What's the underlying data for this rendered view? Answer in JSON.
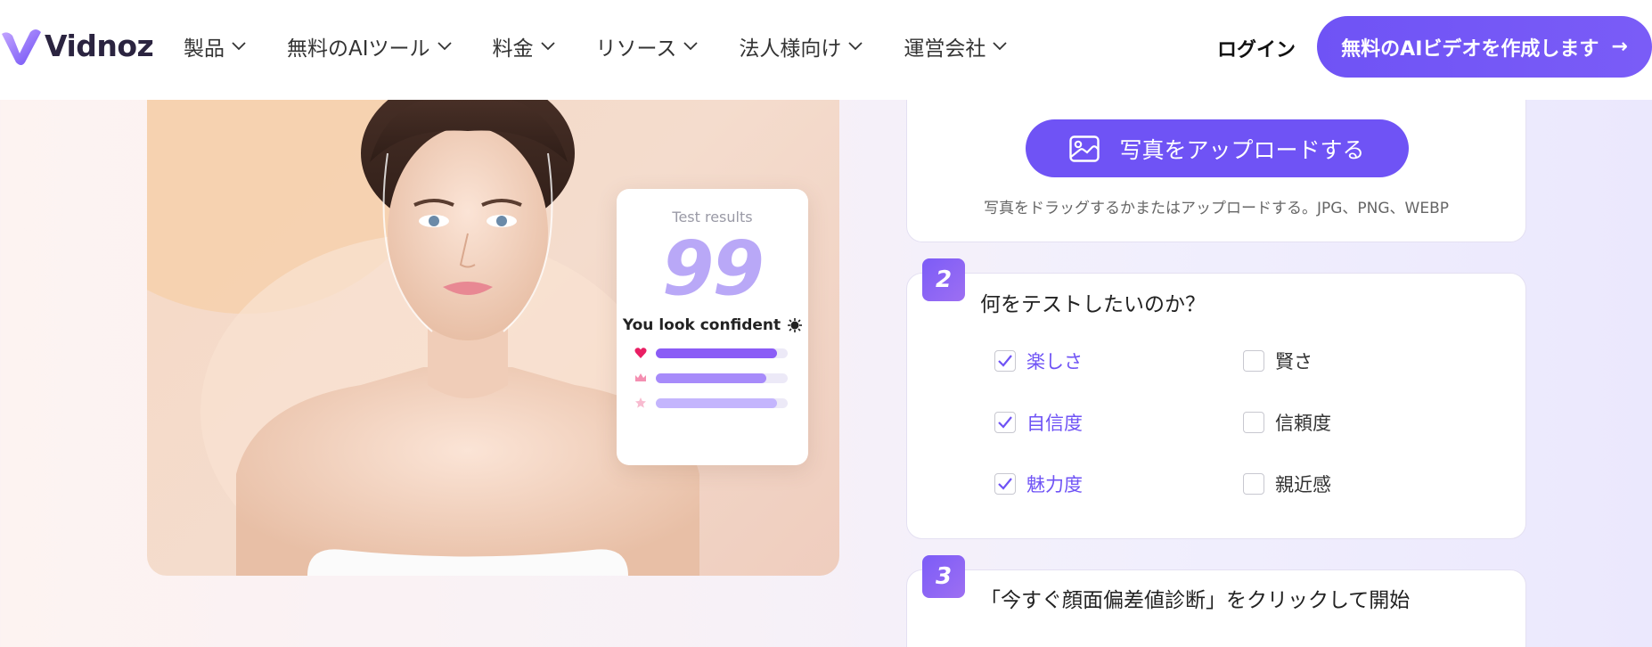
{
  "header": {
    "logo_text": "Vidnoz",
    "nav": [
      {
        "label": "製品"
      },
      {
        "label": "無料のAIツール"
      },
      {
        "label": "料金"
      },
      {
        "label": "リソース"
      },
      {
        "label": "法人様向け"
      },
      {
        "label": "運営会社"
      }
    ],
    "login_label": "ログイン",
    "cta_label": "無料のAIビデオを作成します",
    "cta_arrow": "→"
  },
  "hero": {
    "card": {
      "title": "Test results",
      "score": "99",
      "message": "You look confident",
      "bars": [
        {
          "icon": "heart-icon",
          "fill": 0.92,
          "color": "#8b5cf6"
        },
        {
          "icon": "crown-icon",
          "fill": 0.84,
          "color": "#a78bfa"
        },
        {
          "icon": "star-icon",
          "fill": 0.92,
          "color": "#c4b5fd"
        }
      ]
    }
  },
  "upload": {
    "button_label": "写真をアップロードする",
    "hint": "写真をドラッグするかまたはアップロードする。JPG、PNG、WEBP"
  },
  "step2": {
    "number": "2",
    "title": "何をテストしたいのか？",
    "options": [
      {
        "label": "楽しさ",
        "checked": true
      },
      {
        "label": "賢さ",
        "checked": false
      },
      {
        "label": "自信度",
        "checked": true
      },
      {
        "label": "信頼度",
        "checked": false
      },
      {
        "label": "魅力度",
        "checked": true
      },
      {
        "label": "親近感",
        "checked": false
      }
    ]
  },
  "step3": {
    "number": "3",
    "title": "「今すぐ顔面偏差値診断」をクリックして開始"
  },
  "colors": {
    "accent": "#6f53f5",
    "score": "#b9a8f7"
  }
}
